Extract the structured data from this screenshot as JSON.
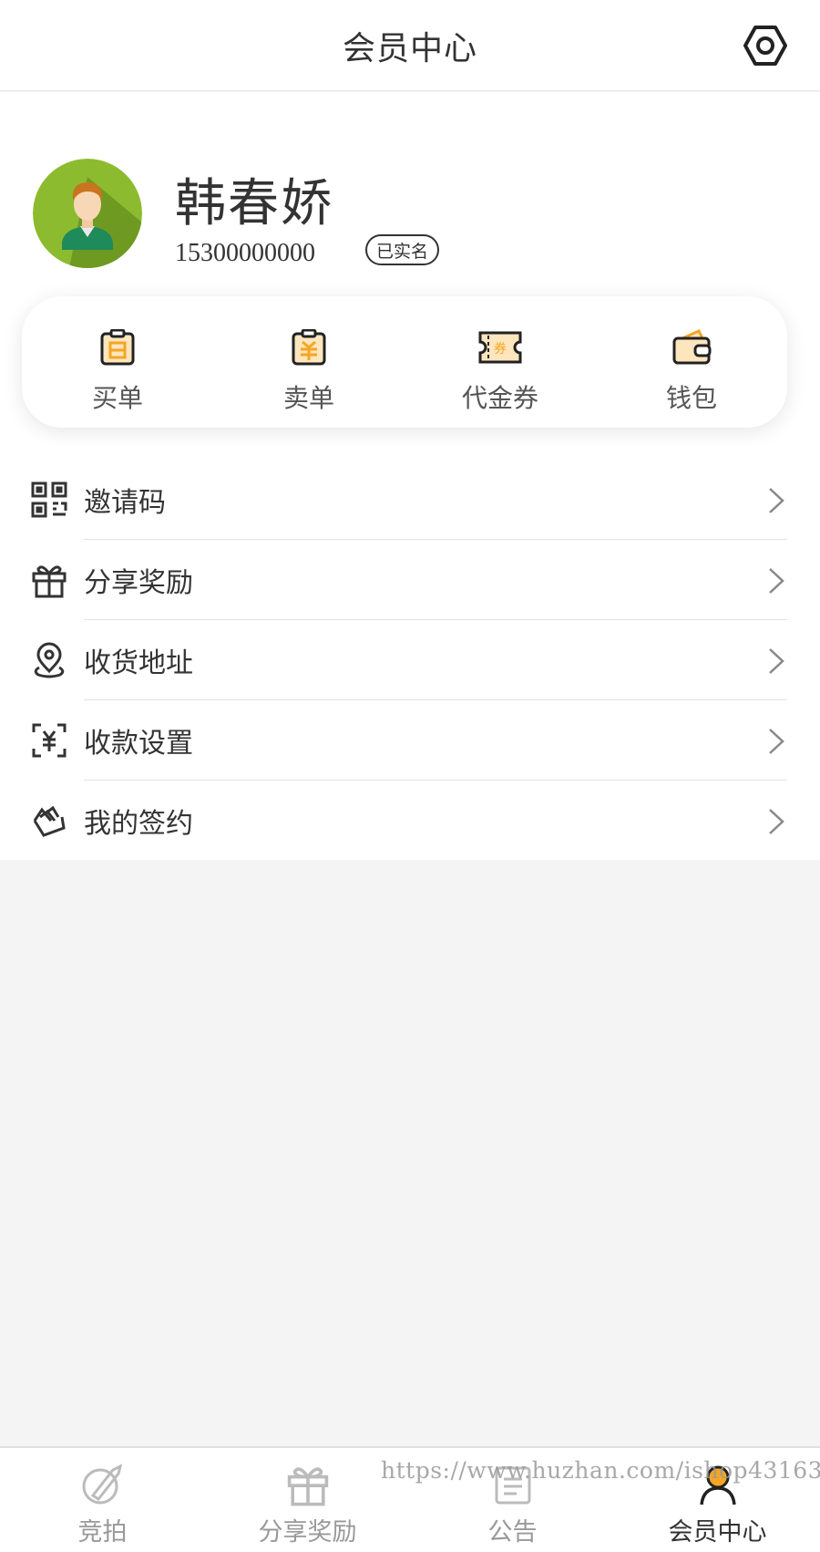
{
  "header": {
    "title": "会员中心"
  },
  "profile": {
    "name": "韩春娇",
    "phone": "15300000000",
    "verified_badge": "已实名"
  },
  "orders_card": {
    "items": [
      {
        "label": "买单",
        "icon": "buy-order-icon"
      },
      {
        "label": "卖单",
        "icon": "sell-order-icon"
      },
      {
        "label": "代金券",
        "icon": "voucher-icon"
      },
      {
        "label": "钱包",
        "icon": "wallet-icon"
      }
    ]
  },
  "menu": {
    "items": [
      {
        "label": "邀请码",
        "icon": "qrcode-icon"
      },
      {
        "label": "分享奖励",
        "icon": "gift-icon"
      },
      {
        "label": "收货地址",
        "icon": "location-icon"
      },
      {
        "label": "收款设置",
        "icon": "payment-icon"
      },
      {
        "label": "我的签约",
        "icon": "sign-icon"
      }
    ]
  },
  "tabbar": {
    "items": [
      {
        "label": "竞拍",
        "icon": "auction-icon",
        "active": false
      },
      {
        "label": "分享奖励",
        "icon": "gift-icon",
        "active": false
      },
      {
        "label": "公告",
        "icon": "notice-icon",
        "active": false
      },
      {
        "label": "会员中心",
        "icon": "member-icon",
        "active": true
      }
    ]
  },
  "watermark": "https://www.huzhan.com/ishop43163",
  "colors": {
    "accent": "#f5a623",
    "accent_light": "#fde6bd",
    "avatar_bg": "#8dbb2f",
    "text": "#333333",
    "muted": "#999999",
    "page_bg": "#f4f4f4"
  }
}
